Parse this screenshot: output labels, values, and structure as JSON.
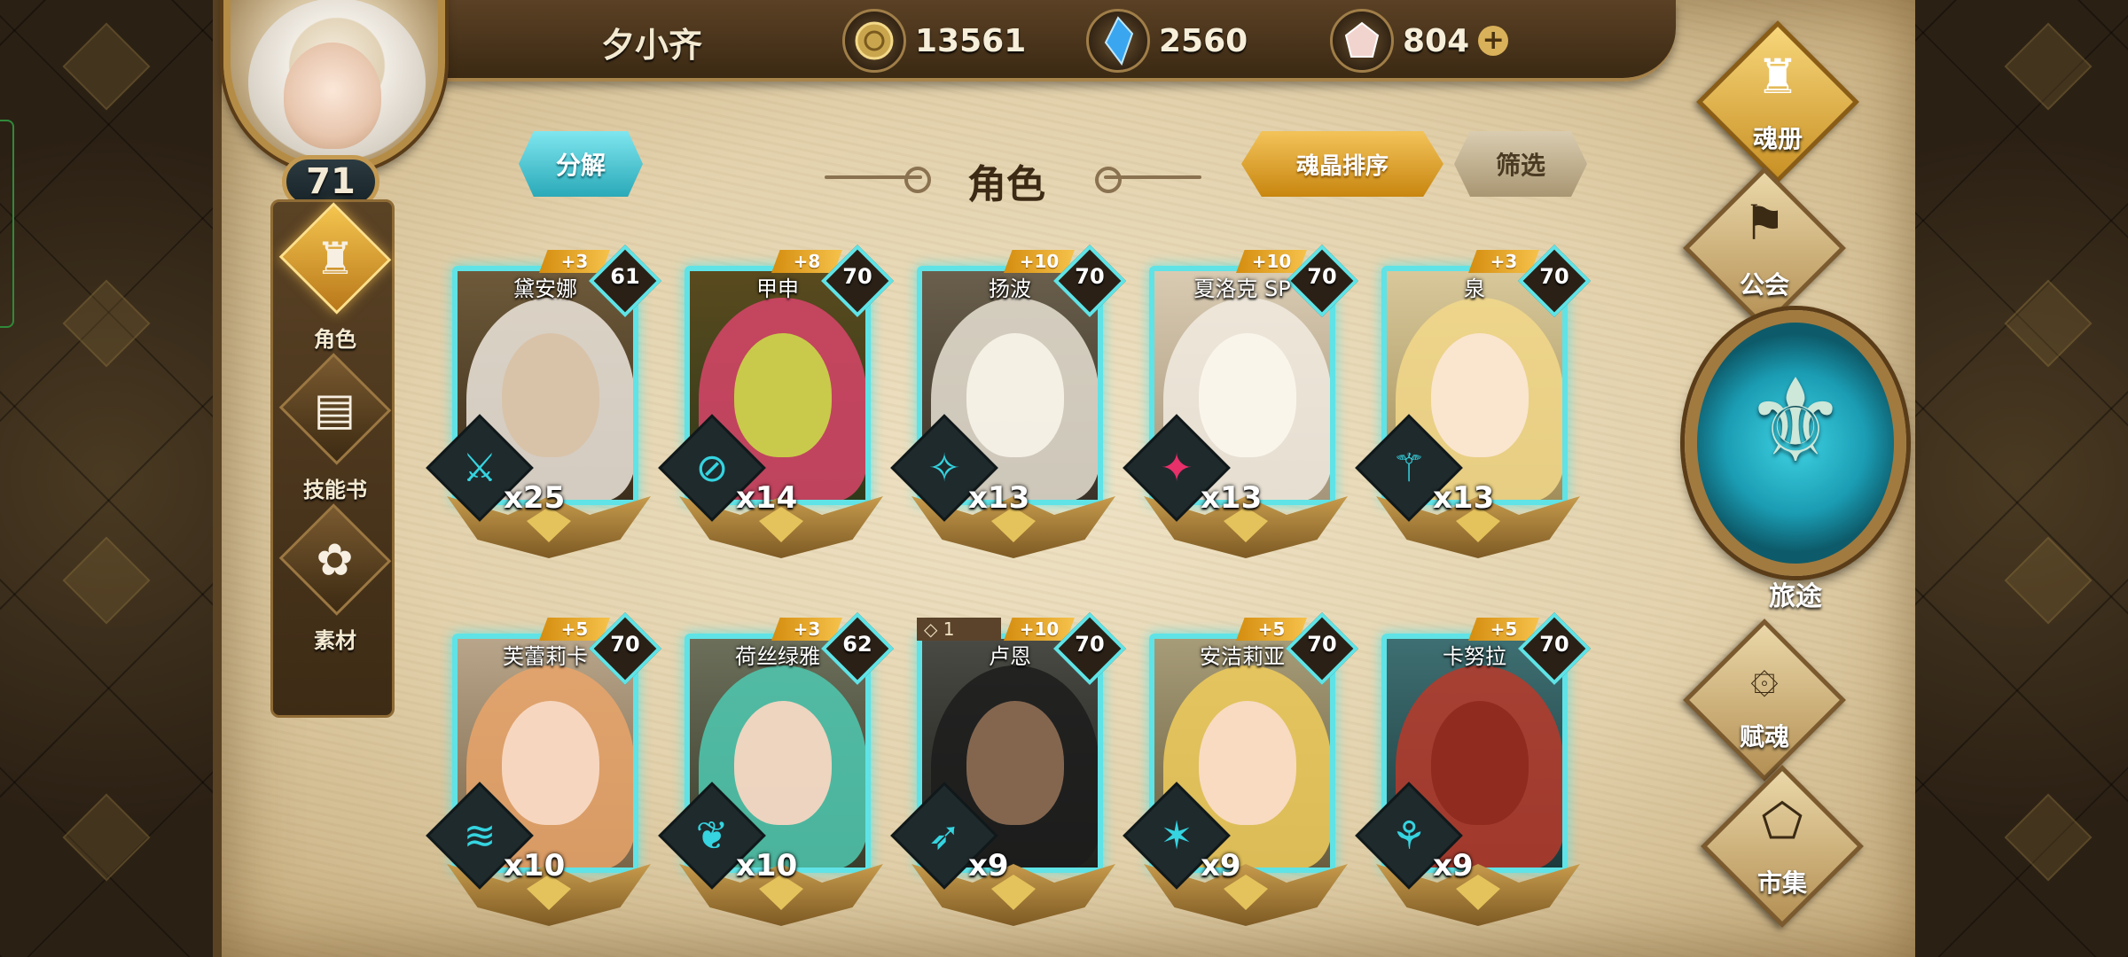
{
  "player": {
    "name": "夕小齐",
    "level": "71"
  },
  "currencies": [
    {
      "icon": "gold-coin-icon",
      "value": "13561"
    },
    {
      "icon": "blue-crystal-icon",
      "value": "2560"
    },
    {
      "icon": "pink-gem-icon",
      "value": "804"
    }
  ],
  "header": {
    "title": "角色",
    "decompose_label": "分解",
    "sort_label": "魂晶排序",
    "filter_label": "筛选"
  },
  "left_nav": [
    {
      "label": "角色",
      "icon": "character-icon",
      "active": true
    },
    {
      "label": "技能书",
      "icon": "skill-book-icon",
      "active": false
    },
    {
      "label": "素材",
      "icon": "material-icon",
      "active": false
    }
  ],
  "right_nav": {
    "soul_book": "魂册",
    "guild": "公会",
    "journey": "旅途",
    "soul_grant": "赋魂",
    "market": "市集"
  },
  "cards": [
    {
      "name": "黛安娜",
      "level": "61",
      "bonus": "+3",
      "count": "x25",
      "class_color": "cyan"
    },
    {
      "name": "甲申",
      "level": "70",
      "bonus": "+8",
      "count": "x14",
      "class_color": "cyan"
    },
    {
      "name": "扬波",
      "level": "70",
      "bonus": "+10",
      "count": "x13",
      "class_color": "cyan"
    },
    {
      "name": "夏洛克 SP",
      "level": "70",
      "bonus": "+10",
      "count": "x13",
      "class_color": "pink"
    },
    {
      "name": "泉",
      "level": "70",
      "bonus": "+3",
      "count": "x13",
      "class_color": "cyan"
    },
    {
      "name": "芙蕾莉卡",
      "level": "70",
      "bonus": "+5",
      "count": "x10",
      "class_color": "cyan"
    },
    {
      "name": "荷丝绿雅",
      "level": "62",
      "bonus": "+3",
      "count": "x10",
      "class_color": "cyan"
    },
    {
      "name": "卢恩",
      "level": "70",
      "bonus": "+10",
      "extra": "◇ 1",
      "count": "x9",
      "class_color": "cyan"
    },
    {
      "name": "安洁莉亚",
      "level": "70",
      "bonus": "+5",
      "count": "x9",
      "class_color": "cyan"
    },
    {
      "name": "卡努拉",
      "level": "70",
      "bonus": "+5",
      "count": "x9",
      "class_color": "cyan"
    }
  ]
}
